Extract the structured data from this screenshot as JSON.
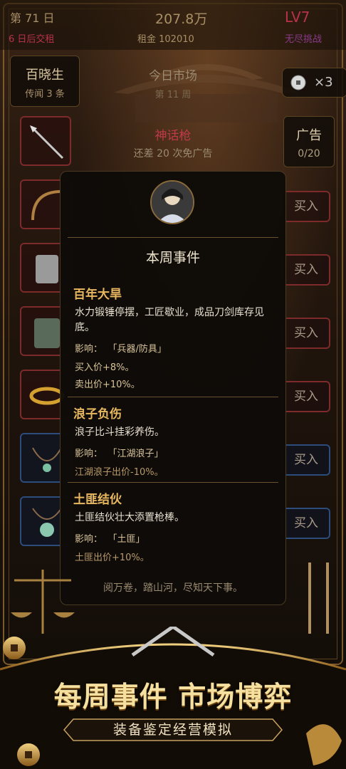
{
  "topbar": {
    "day": "第 71 日",
    "deadline": "6 日后交租",
    "money": "207.8万",
    "rent": "租金 102010",
    "level": "LV7",
    "mode": "无尽挑战"
  },
  "npc": {
    "name": "百晓生",
    "rumor": "传闻 3 条"
  },
  "market": {
    "title": "今日市场",
    "sub": "第 11 周"
  },
  "coin": {
    "count": "×3"
  },
  "featured": {
    "item": "神话枪",
    "ad_hint": "还差 20 次免广告"
  },
  "ad": {
    "label": "广告",
    "progress": "0/20"
  },
  "buy_label": "买入",
  "modal": {
    "title": "本周事件",
    "events": [
      {
        "name": "百年大旱",
        "desc": "水力锻锤停摆，工匠歇业，成品刀剑库存见底。",
        "impact_label": "影响：",
        "impact_target": "「兵器/防具」",
        "effects": [
          "买入价+8%。",
          "卖出价+10%。"
        ]
      },
      {
        "name": "浪子负伤",
        "desc": "浪子比斗挂彩养伤。",
        "impact_label": "影响：",
        "impact_target": "「江湖浪子」",
        "effects": [
          "江湖浪子出价-10%。"
        ]
      },
      {
        "name": "土匪结伙",
        "desc": "土匪结伙壮大添置枪棒。",
        "impact_label": "影响：",
        "impact_target": "「土匪」",
        "effects": [
          "土匪出价+10%。"
        ]
      }
    ]
  },
  "bottom_tagline": "阅万卷，踏山河，尽知天下事。",
  "banner": {
    "headline": "每周事件 市场博弈",
    "subline": "装备鉴定经营模拟"
  },
  "colors": {
    "gold": "#e8b860",
    "red_border": "#7c2a2a",
    "blue_border": "#2c4c7c"
  }
}
